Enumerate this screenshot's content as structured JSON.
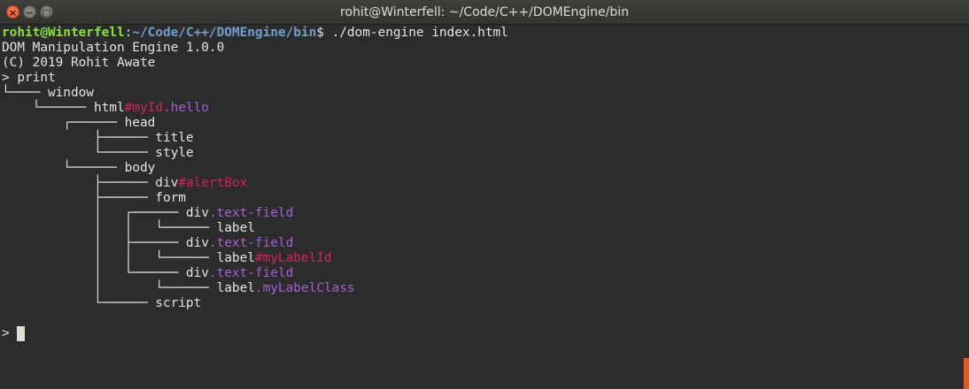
{
  "window": {
    "title": "rohit@Winterfell: ~/Code/C++/DOMEngine/bin",
    "close_glyph": "×",
    "minimize_glyph": "−",
    "maximize_glyph": "□"
  },
  "prompt": {
    "user_host": "rohit@Winterfell",
    "sep": ":",
    "path": "~/Code/C++/DOMEngine/bin",
    "symbol": "$",
    "command": " ./dom-engine index.html"
  },
  "output": {
    "banner": "DOM Manipulation Engine 1.0.0",
    "copyright": "(C) 2019 Rohit Awate",
    "input_line": "> print"
  },
  "tree": [
    [
      {
        "t": "└──── window",
        "c": ""
      }
    ],
    [
      {
        "t": "    └────── html",
        "c": ""
      },
      {
        "t": "#myId",
        "c": "red"
      },
      {
        "t": ".hello",
        "c": "purple"
      }
    ],
    [
      {
        "t": "        ┌────── head",
        "c": ""
      }
    ],
    [
      {
        "t": "            ├────── title",
        "c": ""
      }
    ],
    [
      {
        "t": "            └────── style",
        "c": ""
      }
    ],
    [
      {
        "t": "        └────── body",
        "c": ""
      }
    ],
    [
      {
        "t": "            ├────── div",
        "c": ""
      },
      {
        "t": "#alertBox",
        "c": "red"
      }
    ],
    [
      {
        "t": "            ├────── form",
        "c": ""
      }
    ],
    [
      {
        "t": "            │   ┌────── div",
        "c": ""
      },
      {
        "t": ".text-field",
        "c": "purple"
      }
    ],
    [
      {
        "t": "            │   │   └────── label",
        "c": ""
      }
    ],
    [
      {
        "t": "            │   ├────── div",
        "c": ""
      },
      {
        "t": ".text-field",
        "c": "purple"
      }
    ],
    [
      {
        "t": "            │   │   └────── label",
        "c": ""
      },
      {
        "t": "#myLabelId",
        "c": "red"
      }
    ],
    [
      {
        "t": "            │   └────── div",
        "c": ""
      },
      {
        "t": ".text-field",
        "c": "purple"
      }
    ],
    [
      {
        "t": "            │       └────── label",
        "c": ""
      },
      {
        "t": ".myLabelClass",
        "c": "purple"
      }
    ],
    [
      {
        "t": "            └────── script",
        "c": ""
      }
    ]
  ],
  "blank_line": "",
  "current_input": {
    "prompt": "> "
  },
  "colors": {
    "background": "#2c2c2c",
    "text": "#e4e4e4",
    "user_host": "#8ae234",
    "path": "#729fcf",
    "id": "#d4235b",
    "class": "#a65fd6",
    "scrollbar": "#e05a1e"
  }
}
